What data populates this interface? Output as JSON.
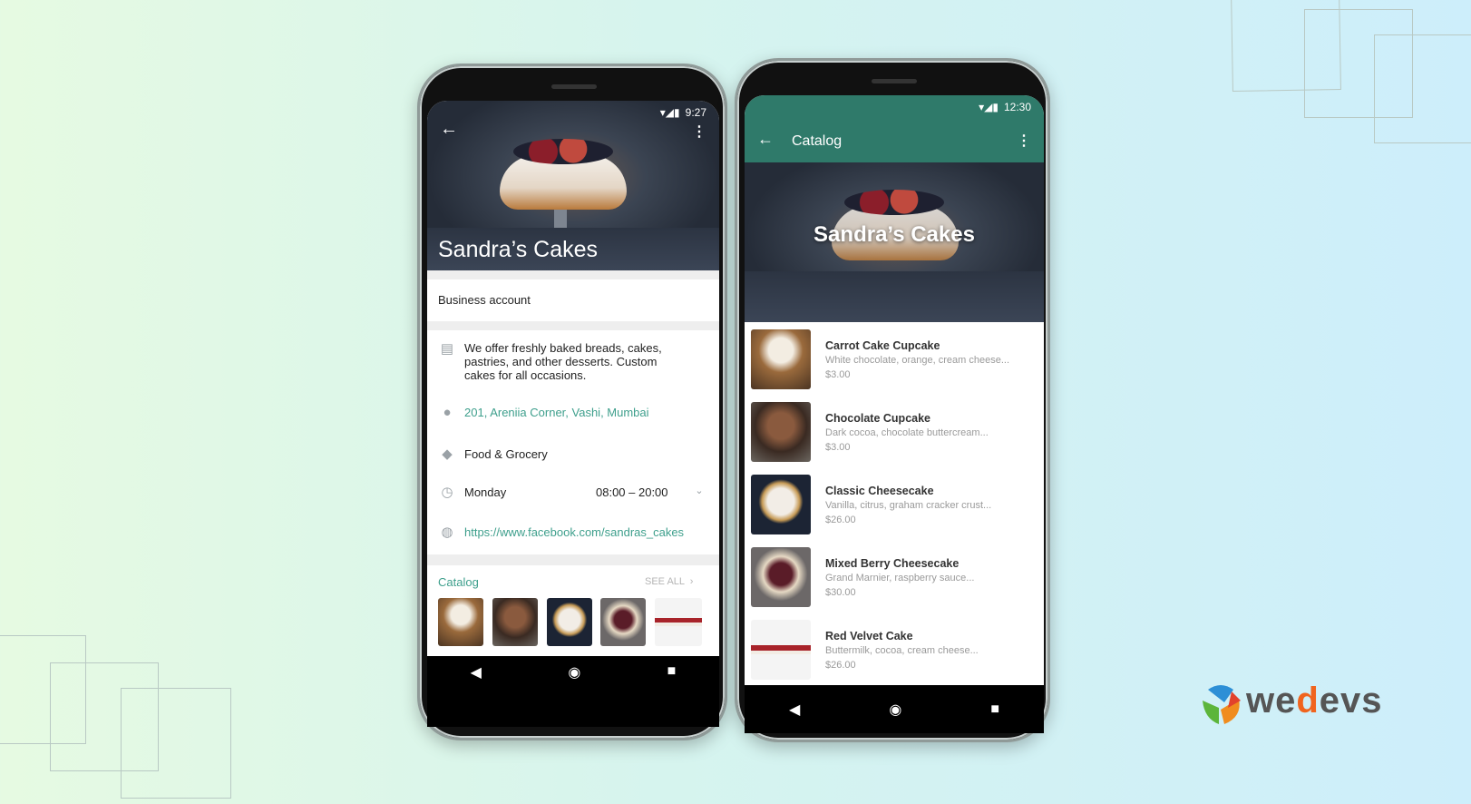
{
  "left_phone": {
    "status_time": "9:27",
    "title": "Sandra’s Cakes",
    "account_type": "Business account",
    "description": "We offer freshly baked breads, cakes, pastries, and other desserts. Custom cakes for all occasions.",
    "address": "201, Areniia Corner, Vashi, Mumbai",
    "category": "Food & Grocery",
    "hours_day": "Monday",
    "hours_time": "08:00 – 20:00",
    "website": "https://www.facebook.com/sandras_cakes",
    "catalog_label": "Catalog",
    "see_all": "SEE ALL"
  },
  "right_phone": {
    "status_time": "12:30",
    "header_title": "Catalog",
    "hero_title": "Sandra’s Cakes",
    "items": [
      {
        "name": "Carrot Cake Cupcake",
        "desc": "White chocolate, orange, cream cheese...",
        "price": "$3.00"
      },
      {
        "name": "Chocolate Cupcake",
        "desc": "Dark cocoa, chocolate buttercream...",
        "price": "$3.00"
      },
      {
        "name": "Classic Cheesecake",
        "desc": "Vanilla, citrus, graham cracker crust...",
        "price": "$26.00"
      },
      {
        "name": "Mixed Berry Cheesecake",
        "desc": "Grand Marnier, raspberry sauce...",
        "price": "$30.00"
      },
      {
        "name": "Red Velvet Cake",
        "desc": "Buttermilk, cocoa, cream cheese...",
        "price": "$26.00"
      }
    ]
  },
  "logo": {
    "text": "wedevs"
  },
  "colors": {
    "accent": "#3e9f8c",
    "header_green": "#2f7a6a",
    "logo_gray": "#555555",
    "logo_orange": "#f0641e"
  }
}
